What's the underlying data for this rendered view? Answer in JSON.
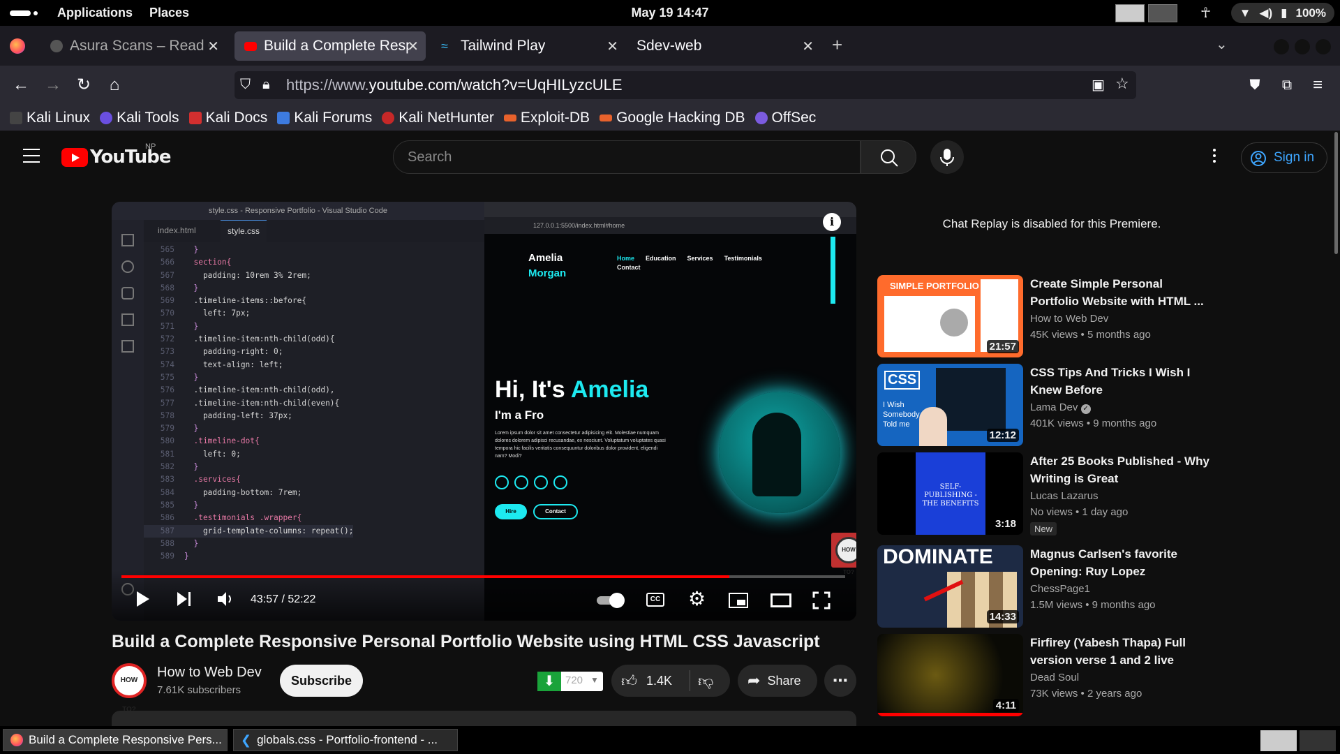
{
  "topbar": {
    "applications": "Applications",
    "places": "Places",
    "clock": "May 19  14:47",
    "battery": "100%"
  },
  "browser": {
    "tabs": [
      {
        "title": "Asura Scans – Read Co",
        "active": false
      },
      {
        "title": "Build a Complete Resp",
        "active": true
      },
      {
        "title": "Tailwind Play",
        "active": false
      },
      {
        "title": "Sdev-web",
        "active": false
      }
    ],
    "url_prefix": "https://www.",
    "url_main": "youtube.com/watch?v=UqHILyzcULE",
    "bookmarks": [
      "Kali Linux",
      "Kali Tools",
      "Kali Docs",
      "Kali Forums",
      "Kali NetHunter",
      "Exploit-DB",
      "Google Hacking DB",
      "OffSec"
    ]
  },
  "youtube": {
    "logo": "YouTube",
    "region": "NP",
    "search_placeholder": "Search",
    "sign_in": "Sign in"
  },
  "player": {
    "vscode_title": "style.css - Responsive Portfolio - Visual Studio Code",
    "tab1": "index.html",
    "tab2": "style.css",
    "code_lines": [
      {
        "n": "565",
        "t": "  }"
      },
      {
        "n": "566",
        "t": "  section{"
      },
      {
        "n": "567",
        "t": "    padding: 10rem 3% 2rem;"
      },
      {
        "n": "568",
        "t": "  }"
      },
      {
        "n": "569",
        "t": "  .timeline-items::before{"
      },
      {
        "n": "570",
        "t": "    left: 7px;"
      },
      {
        "n": "571",
        "t": "  }"
      },
      {
        "n": "572",
        "t": "  .timeline-item:nth-child(odd){"
      },
      {
        "n": "573",
        "t": "    padding-right: 0;"
      },
      {
        "n": "574",
        "t": "    text-align: left;"
      },
      {
        "n": "575",
        "t": "  }"
      },
      {
        "n": "576",
        "t": "  .timeline-item:nth-child(odd),"
      },
      {
        "n": "577",
        "t": "  .timeline-item:nth-child(even){"
      },
      {
        "n": "578",
        "t": "    padding-left: 37px;"
      },
      {
        "n": "579",
        "t": "  }"
      },
      {
        "n": "580",
        "t": "  .timeline-dot{"
      },
      {
        "n": "581",
        "t": "    left: 0;"
      },
      {
        "n": "582",
        "t": "  }"
      },
      {
        "n": "583",
        "t": "  .services{"
      },
      {
        "n": "584",
        "t": "    padding-bottom: 7rem;"
      },
      {
        "n": "585",
        "t": "  }"
      },
      {
        "n": "586",
        "t": "  .testimonials .wrapper{"
      },
      {
        "n": "587",
        "t": "    grid-template-columns: repeat();"
      },
      {
        "n": "588",
        "t": "  }"
      },
      {
        "n": "589",
        "t": "}"
      }
    ],
    "site_url": "127.0.0.1:5500/index.html#home",
    "site_logo1": "Amelia",
    "site_logo2": "Morgan",
    "site_nav": [
      "Home",
      "Education",
      "Services",
      "Testimonials",
      "Contact"
    ],
    "hero_hi": "Hi, It's ",
    "hero_name": "Amelia",
    "hero_sub": "I'm a Fro",
    "hero_body": "Lorem ipsum dolor sit amet consectetur adipisicing elit. Molestiae numquam dolores dolorem adipisci recusandae, ex nesciunt. Voluptatum voluptates quasi tempora hic facilis veritatis consequuntur doloribus dolor provident, eligendi nam? Modi?",
    "btn_hire": "Hire",
    "btn_contact": "Contact",
    "howto_badge": "HOW TO?",
    "time": "43:57 / 52:22",
    "progress": 0.84
  },
  "video": {
    "title": "Build a Complete Responsive Personal Portfolio Website using HTML CSS Javascript",
    "channel": "How to Web Dev",
    "subscribers": "7.61K subscribers",
    "subscribe": "Subscribe",
    "download_quality": "720",
    "likes": "1.4K",
    "share": "Share",
    "avatar_text": "HOW TO?"
  },
  "sidebar": {
    "chat_note": "Chat Replay is disabled for this Premiere.",
    "recs": [
      {
        "title": "Create Simple Personal Portfolio Website with HTML ...",
        "channel": "How to Web Dev",
        "meta": "45K views  • 5 months ago",
        "duration": "21:57",
        "thumb_label": "SIMPLE PORTFOLIO",
        "badge": ""
      },
      {
        "title": "CSS Tips And Tricks I Wish I Knew Before",
        "channel": "Lama Dev",
        "meta": "401K views  • 9 months ago",
        "duration": "12:12",
        "thumb_label": "CSS",
        "thumb_sub": "I Wish Somebody Told me",
        "badge": ""
      },
      {
        "title": "After 25 Books Published - Why Writing is Great",
        "channel": "Lucas Lazarus",
        "meta": "No views  • 1 day ago",
        "duration": "3:18",
        "thumb_label": "SELF-PUBLISHING - THE BENEFITS",
        "badge": "New"
      },
      {
        "title": "Magnus Carlsen's favorite Opening: Ruy Lopez",
        "channel": "ChessPage1",
        "meta": "1.5M views  • 9 months ago",
        "duration": "14:33",
        "thumb_label": "DOMINATE",
        "badge": ""
      },
      {
        "title": "Firfirey (Yabesh Thapa) Full version verse 1 and 2 live",
        "channel": "Dead Soul",
        "meta": "73K views  • 2 years ago",
        "duration": "4:11",
        "thumb_label": "",
        "badge": ""
      }
    ]
  },
  "taskbar": {
    "items": [
      "Build a Complete Responsive Pers...",
      "globals.css - Portfolio-frontend - ..."
    ]
  }
}
